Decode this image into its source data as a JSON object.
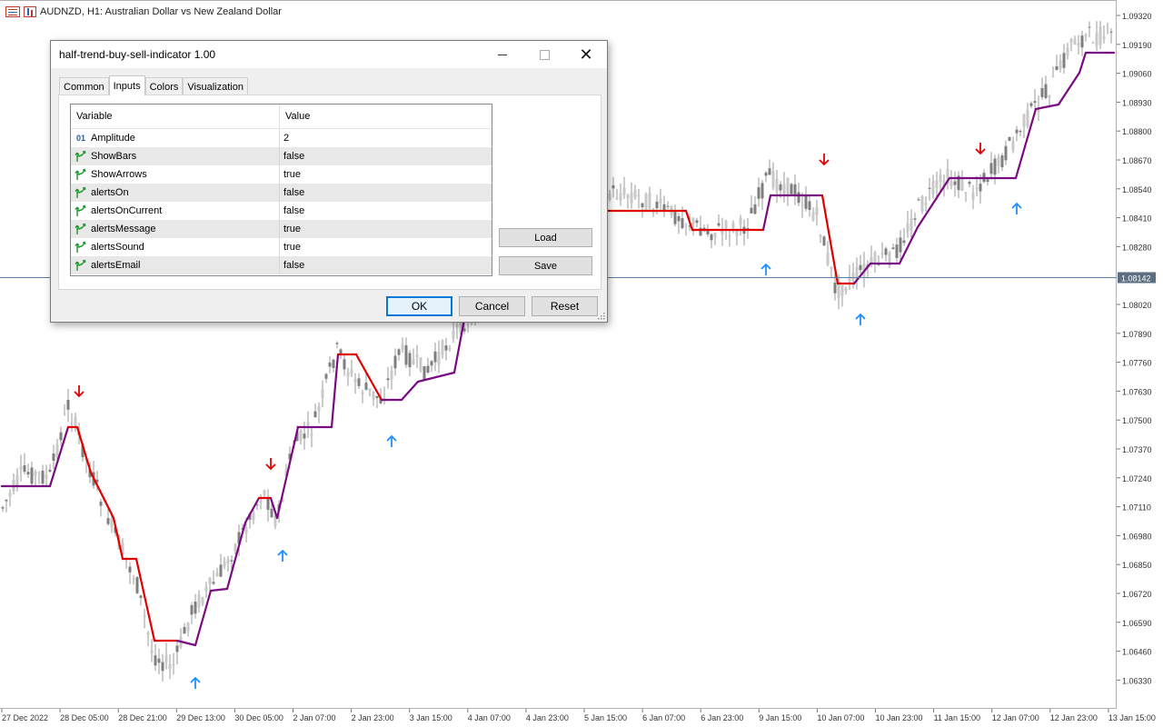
{
  "chart": {
    "symbol_title": "AUDNZD, H1:  Australian Dollar vs New Zealand Dollar",
    "current_price": "1.08142",
    "price_levels": [
      "1.09320",
      "1.09190",
      "1.09060",
      "1.08930",
      "1.08800",
      "1.08670",
      "1.08540",
      "1.08410",
      "1.08280",
      "1.08020",
      "1.07890",
      "1.07760",
      "1.07630",
      "1.07500",
      "1.07370",
      "1.07240",
      "1.07110",
      "1.06980",
      "1.06850",
      "1.06720",
      "1.06590",
      "1.06460",
      "1.06330"
    ],
    "time_labels": [
      "27 Dec 2022",
      "28 Dec 05:00",
      "28 Dec 21:00",
      "29 Dec 13:00",
      "30 Dec 05:00",
      "2 Jan 07:00",
      "2 Jan 23:00",
      "3 Jan 15:00",
      "4 Jan 07:00",
      "4 Jan 23:00",
      "5 Jan 15:00",
      "6 Jan 07:00",
      "6 Jan 23:00",
      "9 Jan 15:00",
      "10 Jan 07:00",
      "10 Jan 23:00",
      "11 Jan 15:00",
      "12 Jan 07:00",
      "12 Jan 23:00",
      "13 Jan 15:00"
    ],
    "colors": {
      "buy": "#7a0a82",
      "sell": "#e00000",
      "up_arrow": "#1e90ff",
      "down_arrow": "#e00000",
      "candle": "#8c8c8c",
      "price_line": "#5b7fa6"
    }
  },
  "dialog": {
    "title": "half-trend-buy-sell-indicator 1.00",
    "tabs": [
      "Common",
      "Inputs",
      "Colors",
      "Visualization"
    ],
    "active_tab": "Inputs",
    "grid": {
      "col_variable": "Variable",
      "col_value": "Value",
      "rows": [
        {
          "type": "int",
          "type_label": "01",
          "name": "Amplitude",
          "value": "2"
        },
        {
          "type": "bool",
          "name": "ShowBars",
          "value": "false"
        },
        {
          "type": "bool",
          "name": "ShowArrows",
          "value": "true"
        },
        {
          "type": "bool",
          "name": "alertsOn",
          "value": "false"
        },
        {
          "type": "bool",
          "name": "alertsOnCurrent",
          "value": "false"
        },
        {
          "type": "bool",
          "name": "alertsMessage",
          "value": "true"
        },
        {
          "type": "bool",
          "name": "alertsSound",
          "value": "true"
        },
        {
          "type": "bool",
          "name": "alertsEmail",
          "value": "false"
        }
      ]
    },
    "load_label": "Load",
    "save_label": "Save",
    "ok_label": "OK",
    "cancel_label": "Cancel",
    "reset_label": "Reset"
  }
}
